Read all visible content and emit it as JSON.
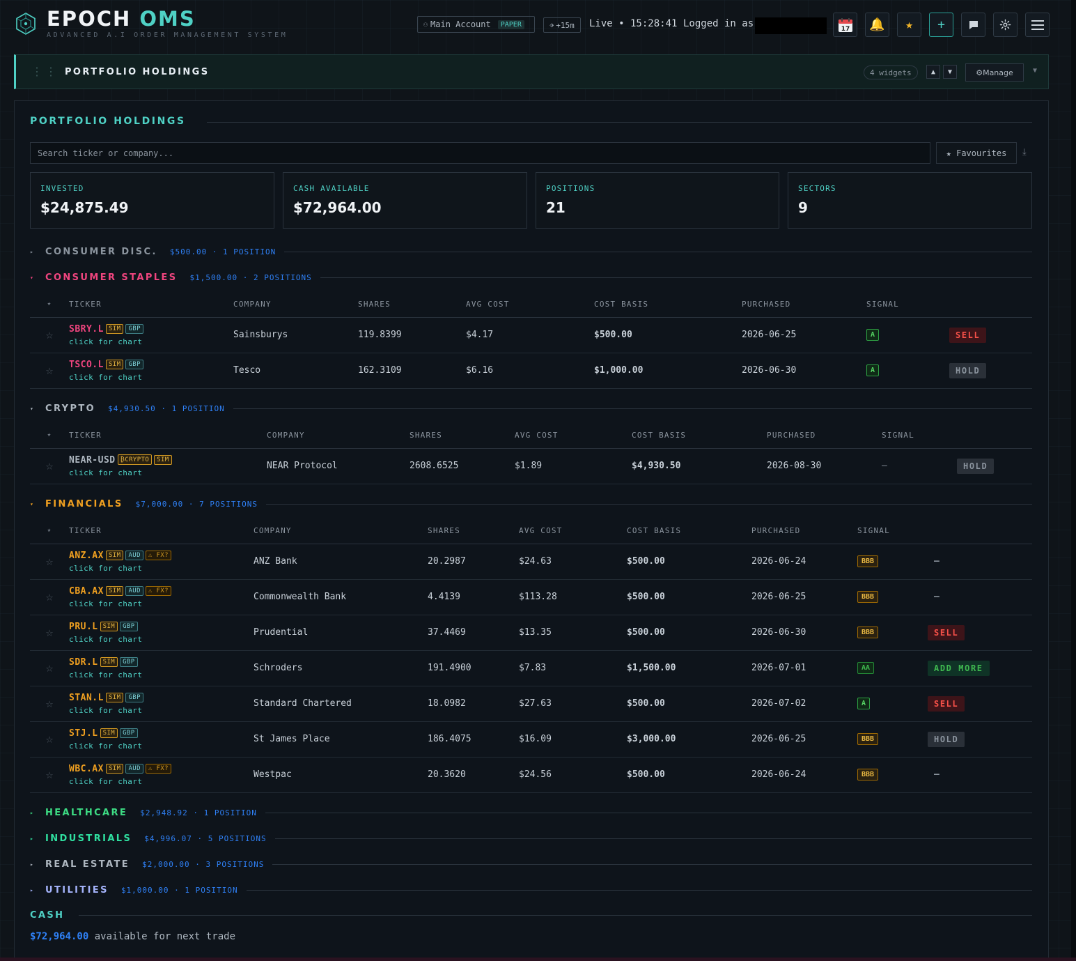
{
  "header": {
    "brand_main": "EPOCH ",
    "brand_accent": "OMS",
    "tagline": "ADVANCED A.I ORDER MANAGEMENT SYSTEM",
    "account_label": "Main Account",
    "account_mode": "PAPER",
    "delay": "+15m",
    "live_status": "Live • 15:28:41",
    "logged_in": "Logged in as",
    "calendar_day": "17"
  },
  "widget": {
    "title": "PORTFOLIO HOLDINGS",
    "count": "4 widgets",
    "up": "▲",
    "down": "▼",
    "manage": "⚙Manage",
    "collapse": "▼"
  },
  "panel": {
    "title": "PORTFOLIO HOLDINGS",
    "search_placeholder": "Search ticker or company...",
    "favourites": "★ Favourites",
    "download": "⤓"
  },
  "stats": [
    {
      "label": "INVESTED",
      "value": "$24,875.49"
    },
    {
      "label": "CASH AVAILABLE",
      "value": "$72,964.00"
    },
    {
      "label": "POSITIONS",
      "value": "21"
    },
    {
      "label": "SECTORS",
      "value": "9"
    }
  ],
  "colors": {
    "consumer_disc": "#8b949e",
    "consumer_staples": "#f0457f",
    "crypto": "#aeb7c0",
    "financials": "#f0a020",
    "healthcare": "#3ddc84",
    "industrials": "#2fe0a0",
    "real_estate": "#aeb7c0",
    "utilities": "#a5b4fc"
  },
  "sectors": {
    "consumer_disc": {
      "caret": "▸",
      "name": "CONSUMER DISC.",
      "summary": "$500.00 · 1 POSITION"
    },
    "consumer_staples": {
      "caret": "▾",
      "name": "CONSUMER STAPLES",
      "summary": "$1,500.00 · 2 POSITIONS"
    },
    "crypto": {
      "caret": "▾",
      "name": "CRYPTO",
      "summary": "$4,930.50 · 1 POSITION"
    },
    "financials": {
      "caret": "▾",
      "name": "FINANCIALS",
      "summary": "$7,000.00 · 7 POSITIONS"
    },
    "healthcare": {
      "caret": "▸",
      "name": "HEALTHCARE",
      "summary": "$2,948.92 · 1 POSITION"
    },
    "industrials": {
      "caret": "▸",
      "name": "INDUSTRIALS",
      "summary": "$4,996.07 · 5 POSITIONS"
    },
    "real_estate": {
      "caret": "▸",
      "name": "REAL ESTATE",
      "summary": "$2,000.00 · 3 POSITIONS"
    },
    "utilities": {
      "caret": "▸",
      "name": "UTILITIES",
      "summary": "$1,000.00 · 1 POSITION"
    }
  },
  "columns": {
    "star": "★",
    "ticker": "TICKER",
    "company": "COMPANY",
    "shares": "SHARES",
    "avg_cost": "AVG COST",
    "cost_basis": "COST BASIS",
    "purchased": "PURCHASED",
    "signal": "SIGNAL"
  },
  "chart_hint": "click for chart",
  "tables": {
    "consumer_staples": [
      {
        "ticker": "SBRY.L",
        "badges": [
          "SIM",
          "GBP"
        ],
        "company": "Sainsburys",
        "shares": "119.8399",
        "avg_cost": "$4.17",
        "cost_basis": "$500.00",
        "purchased": "2026-06-25",
        "grade": "A",
        "signal": "SELL"
      },
      {
        "ticker": "TSCO.L",
        "badges": [
          "SIM",
          "GBP"
        ],
        "company": "Tesco",
        "shares": "162.3109",
        "avg_cost": "$6.16",
        "cost_basis": "$1,000.00",
        "purchased": "2026-06-30",
        "grade": "A",
        "signal": "HOLD"
      }
    ],
    "crypto": [
      {
        "ticker": "NEAR-USD",
        "badges": [
          "₿CRYPTO",
          "SIM"
        ],
        "company": "NEAR Protocol",
        "shares": "2608.6525",
        "avg_cost": "$1.89",
        "cost_basis": "$4,930.50",
        "purchased": "2026-08-30",
        "grade": "–",
        "signal": "HOLD"
      }
    ],
    "financials": [
      {
        "ticker": "ANZ.AX",
        "badges": [
          "SIM",
          "AUD",
          "⚠ FX?"
        ],
        "company": "ANZ Bank",
        "shares": "20.2987",
        "avg_cost": "$24.63",
        "cost_basis": "$500.00",
        "purchased": "2026-06-24",
        "grade": "BBB",
        "signal": "—"
      },
      {
        "ticker": "CBA.AX",
        "badges": [
          "SIM",
          "AUD",
          "⚠ FX?"
        ],
        "company": "Commonwealth Bank",
        "shares": "4.4139",
        "avg_cost": "$113.28",
        "cost_basis": "$500.00",
        "purchased": "2026-06-25",
        "grade": "BBB",
        "signal": "—"
      },
      {
        "ticker": "PRU.L",
        "badges": [
          "SIM",
          "GBP"
        ],
        "company": "Prudential",
        "shares": "37.4469",
        "avg_cost": "$13.35",
        "cost_basis": "$500.00",
        "purchased": "2026-06-30",
        "grade": "BBB",
        "signal": "SELL"
      },
      {
        "ticker": "SDR.L",
        "badges": [
          "SIM",
          "GBP"
        ],
        "company": "Schroders",
        "shares": "191.4900",
        "avg_cost": "$7.83",
        "cost_basis": "$1,500.00",
        "purchased": "2026-07-01",
        "grade": "AA",
        "signal": "ADD MORE"
      },
      {
        "ticker": "STAN.L",
        "badges": [
          "SIM",
          "GBP"
        ],
        "company": "Standard Chartered",
        "shares": "18.0982",
        "avg_cost": "$27.63",
        "cost_basis": "$500.00",
        "purchased": "2026-07-02",
        "grade": "A",
        "signal": "SELL"
      },
      {
        "ticker": "STJ.L",
        "badges": [
          "SIM",
          "GBP"
        ],
        "company": "St James Place",
        "shares": "186.4075",
        "avg_cost": "$16.09",
        "cost_basis": "$3,000.00",
        "purchased": "2026-06-25",
        "grade": "BBB",
        "signal": "HOLD"
      },
      {
        "ticker": "WBC.AX",
        "badges": [
          "SIM",
          "AUD",
          "⚠ FX?"
        ],
        "company": "Westpac",
        "shares": "20.3620",
        "avg_cost": "$24.56",
        "cost_basis": "$500.00",
        "purchased": "2026-06-24",
        "grade": "BBB",
        "signal": "—"
      }
    ]
  },
  "cash": {
    "title": "CASH",
    "amount": "$72,964.00",
    "suffix": " available for next trade"
  }
}
